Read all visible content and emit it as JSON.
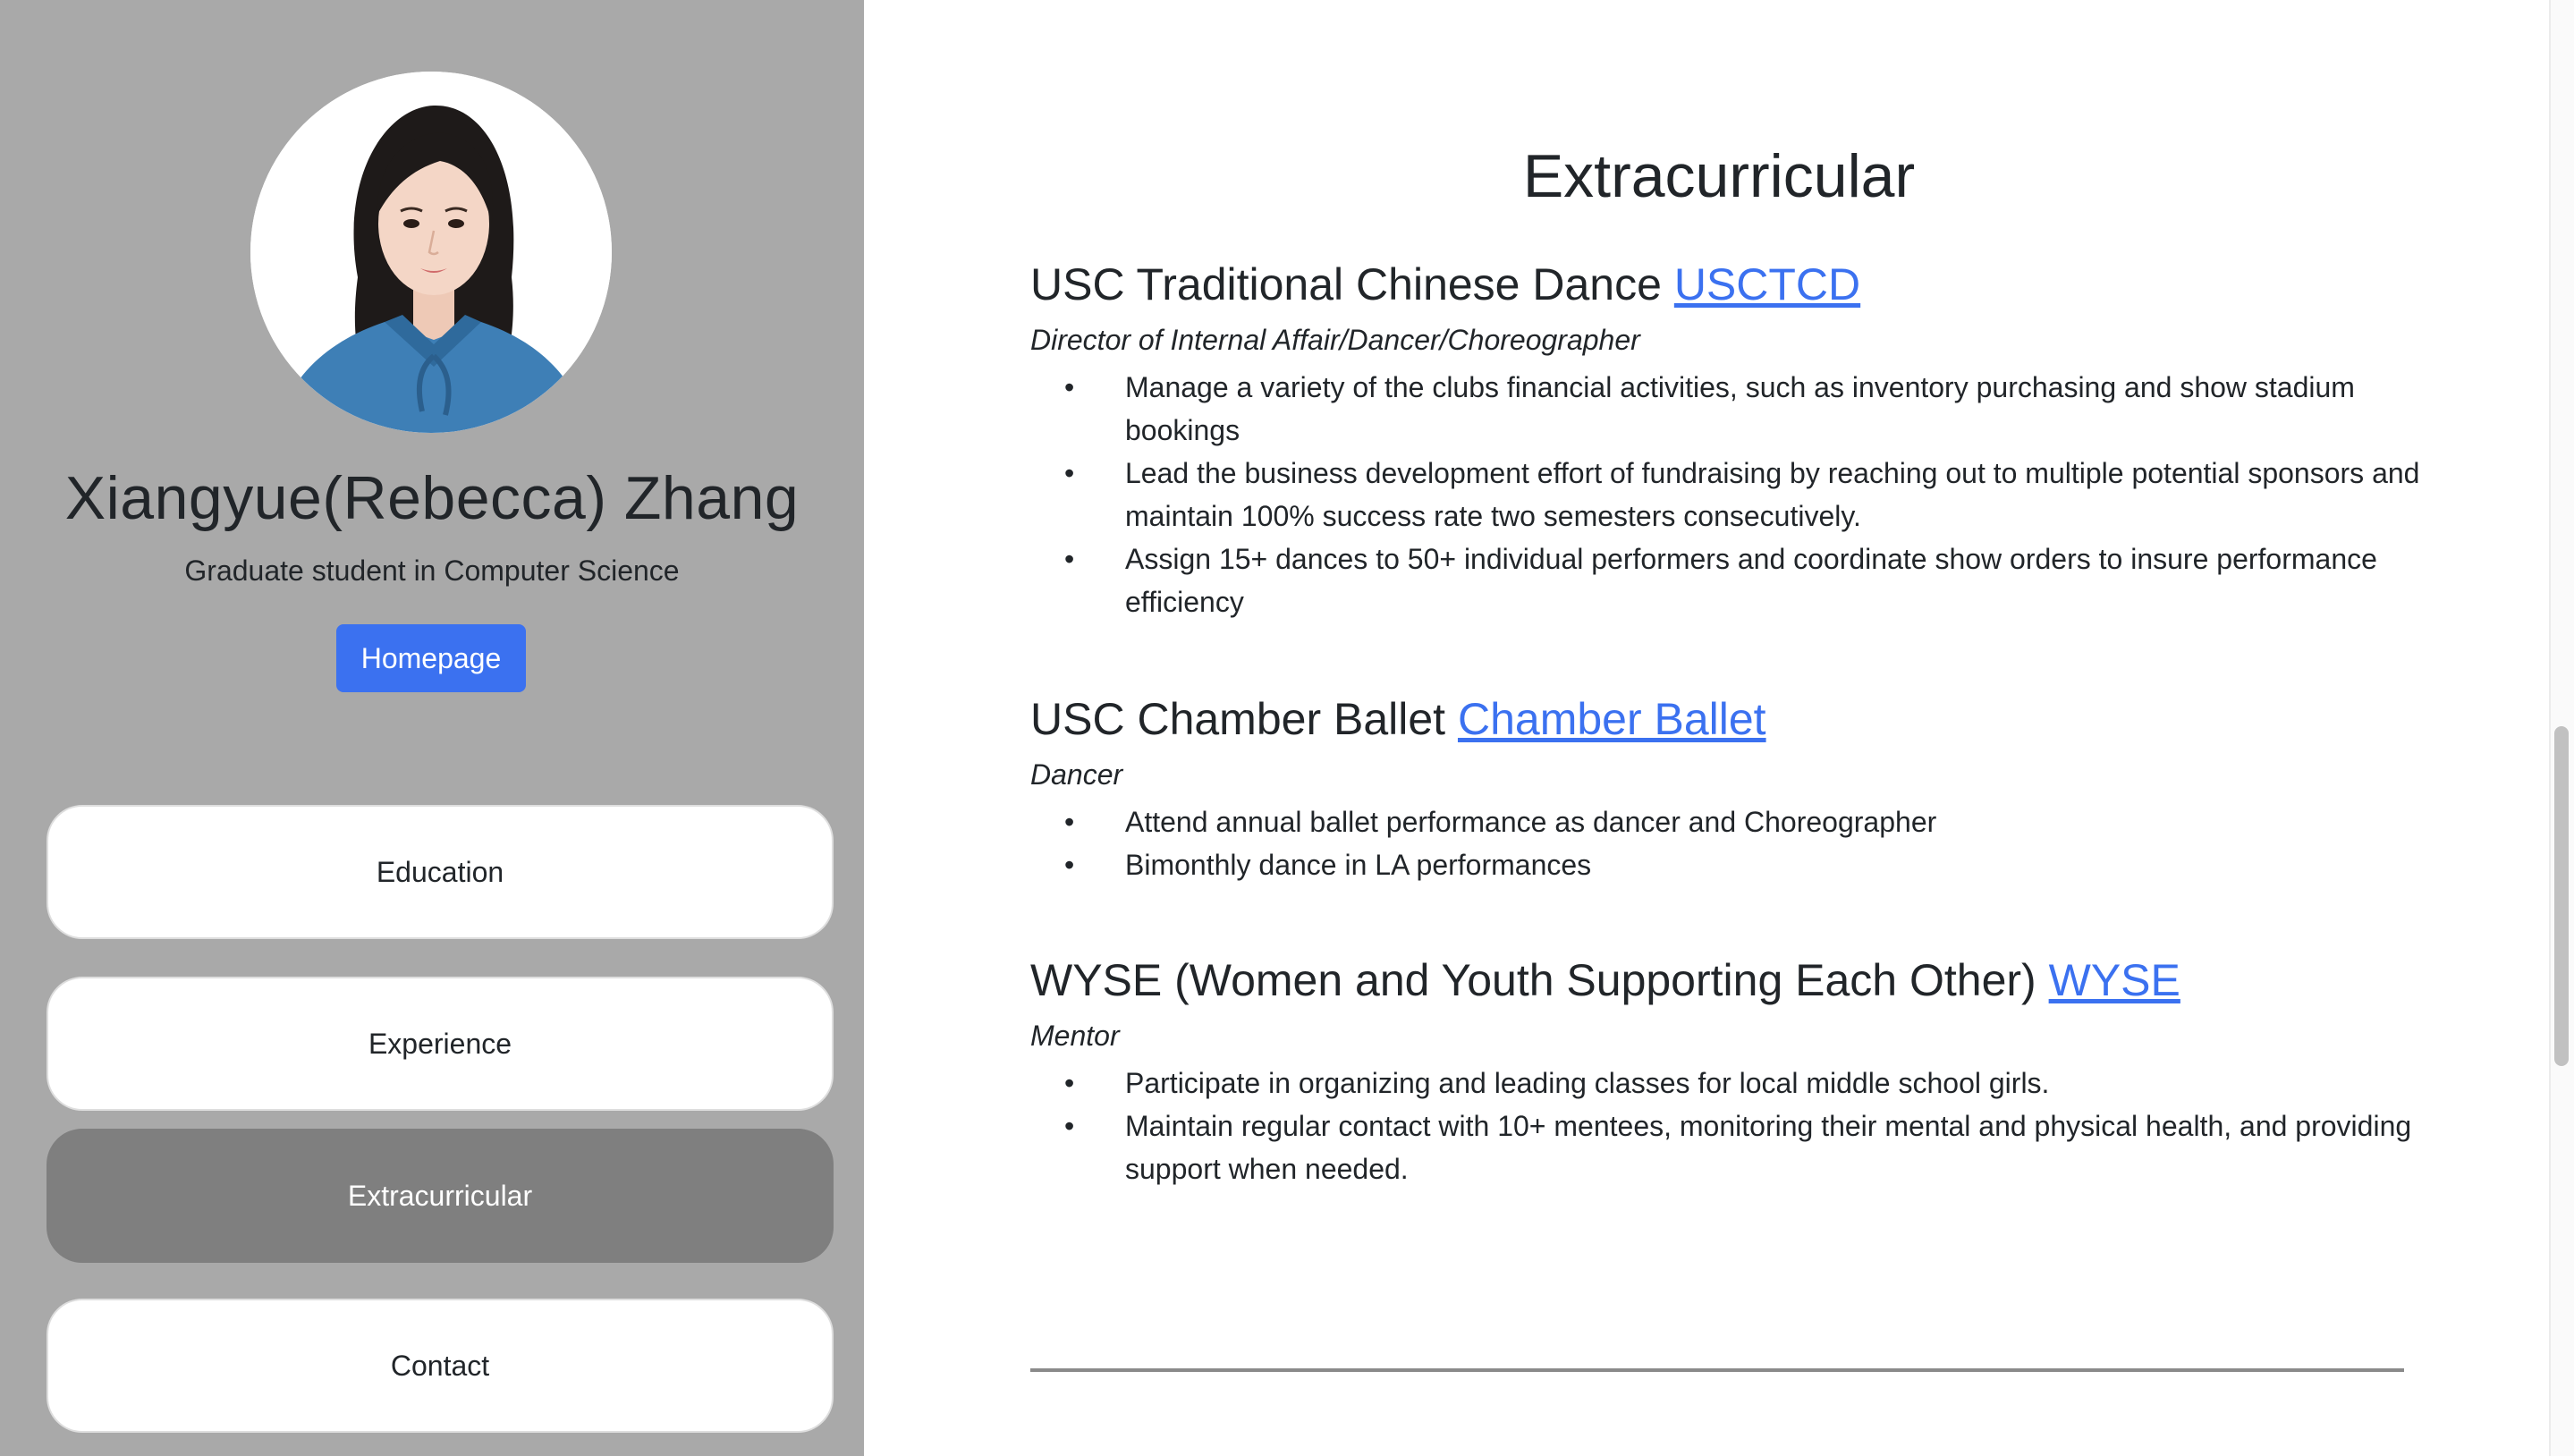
{
  "profile": {
    "name": "Xiangyue(Rebecca) Zhang",
    "subtitle": "Graduate student in Computer Science",
    "homepage_label": "Homepage"
  },
  "nav": {
    "items": [
      {
        "label": "Education",
        "active": false
      },
      {
        "label": "Experience",
        "active": false
      },
      {
        "label": "Extracurricular",
        "active": true
      },
      {
        "label": "Contact",
        "active": false
      }
    ]
  },
  "main": {
    "title": "Extracurricular",
    "sections": [
      {
        "heading": "USC Traditional Chinese Dance",
        "link_label": "USCTCD",
        "role": "Director of Internal Affair/Dancer/Choreographer",
        "bullets": [
          "Manage a variety of the clubs financial activities, such as inventory purchasing and show stadium bookings",
          "Lead the business development effort of fundraising by reaching out to multiple potential sponsors and maintain 100% success rate two semesters consecutively.",
          "Assign 15+ dances to 50+ individual performers and coordinate show orders to insure performance efficiency"
        ]
      },
      {
        "heading": "USC Chamber Ballet",
        "link_label": "Chamber Ballet",
        "role": "Dancer",
        "bullets": [
          "Attend annual ballet performance as dancer and Choreographer",
          "Bimonthly dance in LA performances"
        ]
      },
      {
        "heading": "WYSE (Women and Youth Supporting Each Other)",
        "link_label": "WYSE",
        "role": "Mentor",
        "bullets": [
          "Participate in organizing and leading classes for local middle school girls.",
          "Maintain regular contact with 10+ mentees, monitoring their mental and physical health, and providing support when needed."
        ]
      }
    ]
  },
  "icons": {
    "bullet": "•",
    "avatar": "profile-photo"
  },
  "colors": {
    "sidebar_bg": "#a9a9a9",
    "accent": "#3b71f0",
    "nav_active_bg": "#7f7f7f",
    "text": "#212529"
  }
}
